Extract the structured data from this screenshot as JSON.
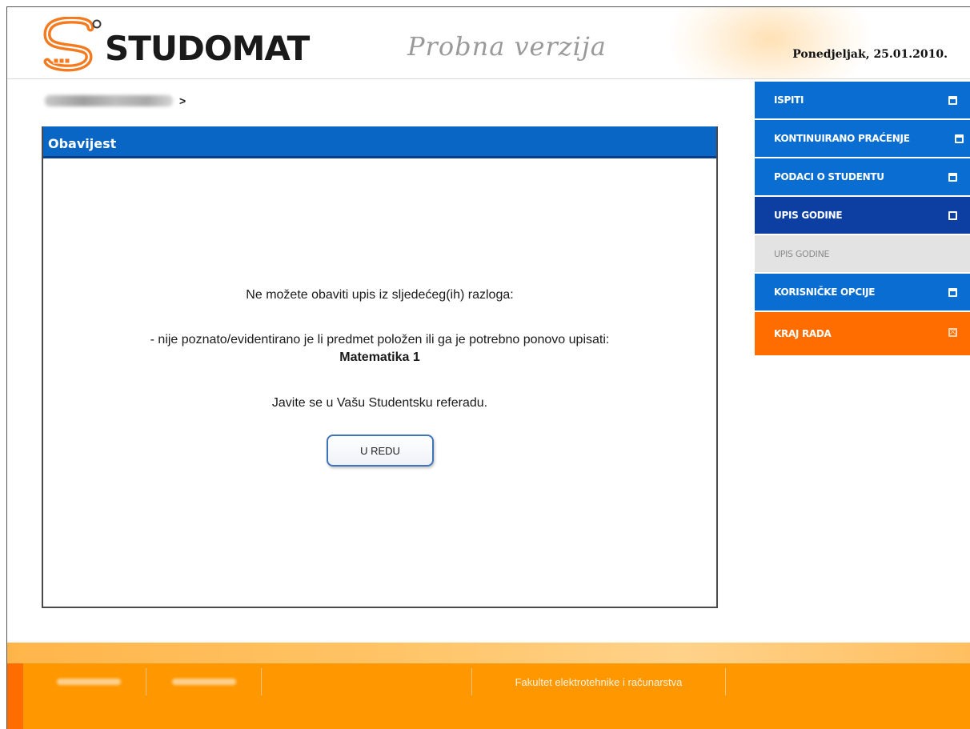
{
  "header": {
    "logo_text": "STUDOMAT",
    "subtitle": "Probna verzija",
    "date": "Ponedjeljak, 25.01.2010."
  },
  "breadcrumb": {
    "separator": ">"
  },
  "notice": {
    "title": "Obavijest",
    "line1": "Ne možete obaviti upis iz sljedećeg(ih) razloga:",
    "line2": "- nije poznato/evidentirano je li predmet položen ili ga je potrebno ponovo upisati:",
    "subject": "Matematika 1",
    "line3": "Javite se u Vašu Studentsku referadu.",
    "ok_label": "U REDU"
  },
  "nav": {
    "items": [
      {
        "label": "ISPITI",
        "icon": "expand-icon",
        "color": "#0a6dd1"
      },
      {
        "label": "KONTINUIRANO PRAĆENJE",
        "icon": "expand-icon",
        "color": "#0a6dd1"
      },
      {
        "label": "PODACI O STUDENTU",
        "icon": "expand-icon",
        "color": "#0a6dd1"
      },
      {
        "label": "UPIS GODINE",
        "icon": "collapse-icon",
        "color": "#0d3fa3"
      },
      {
        "label": "UPIS GODINE",
        "icon": "",
        "color": "#e3e3e3"
      },
      {
        "label": "KORISNIČKE OPCIJE",
        "icon": "expand-icon",
        "color": "#0a6dd1"
      },
      {
        "label": "KRAJ RADA",
        "icon": "close-icon",
        "color": "#ff6d00"
      }
    ]
  },
  "footer": {
    "faculty": "Fakultet elektrotehnike i računarstva"
  }
}
